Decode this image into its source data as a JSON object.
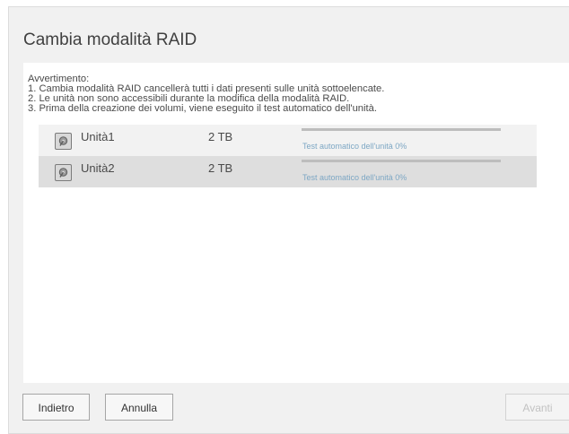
{
  "dialog": {
    "title": "Cambia modalità RAID"
  },
  "warning": {
    "heading": "Avvertimento:",
    "lines": [
      "1. Cambia modalità RAID cancellerà tutti i dati presenti sulle unità sottoelencate.",
      "2. Le unità non sono accessibili durante la modifica della modalità RAID.",
      "3. Prima della creazione dei volumi, viene eseguito il test automatico dell'unità."
    ]
  },
  "drives": [
    {
      "name": "Unità1",
      "size": "2 TB",
      "status": "Test automatico dell'unità 0%",
      "progress_percent": 0,
      "icon": "hard-drive-icon"
    },
    {
      "name": "Unità2",
      "size": "2 TB",
      "status": "Test automatico dell'unità 0%",
      "progress_percent": 0,
      "icon": "hard-drive-icon"
    }
  ],
  "buttons": {
    "back": "Indietro",
    "cancel": "Annulla",
    "next": "Avanti",
    "next_enabled": false
  },
  "colors": {
    "progress_track": "#bdbdbd",
    "progress_fill": "#2f9fd8",
    "status_text": "#7da7c4",
    "row_odd": "#f2f2f2",
    "row_even": "#dedede"
  }
}
